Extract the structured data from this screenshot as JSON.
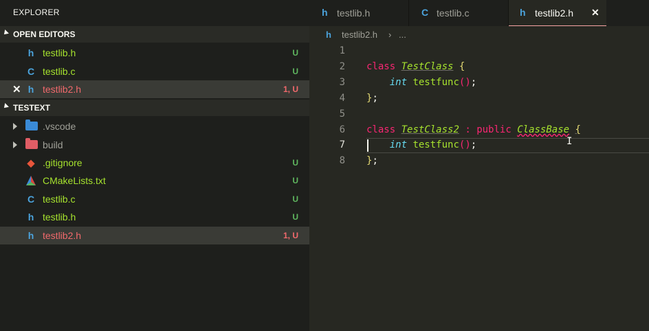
{
  "sidebar": {
    "title": "EXPLORER",
    "open_editors": {
      "label": "OPEN EDITORS",
      "items": [
        {
          "icon": "h",
          "name": "testlib.h",
          "badge": "U"
        },
        {
          "icon": "C",
          "name": "testlib.c",
          "badge": "U"
        },
        {
          "icon": "h",
          "name": "testlib2.h",
          "badge": "1, U",
          "close": "✕"
        }
      ]
    },
    "workspace": {
      "label": "TESTEXT",
      "items": [
        {
          "name": ".vscode"
        },
        {
          "name": "build"
        },
        {
          "name": ".gitignore",
          "badge": "U"
        },
        {
          "name": "CMakeLists.txt",
          "badge": "U"
        },
        {
          "icon": "C",
          "name": "testlib.c",
          "badge": "U"
        },
        {
          "icon": "h",
          "name": "testlib.h",
          "badge": "U"
        },
        {
          "icon": "h",
          "name": "testlib2.h",
          "badge": "1, U"
        }
      ]
    }
  },
  "tabs": [
    {
      "icon": "h",
      "label": "testlib.h"
    },
    {
      "icon": "C",
      "label": "testlib.c"
    },
    {
      "icon": "h",
      "label": "testlib2.h",
      "close": "✕"
    }
  ],
  "breadcrumb": {
    "icon": "h",
    "file": "testlib2.h",
    "sep": "›",
    "more": "..."
  },
  "editor": {
    "line_numbers": [
      "1",
      "2",
      "3",
      "4",
      "5",
      "6",
      "7",
      "8"
    ],
    "current_line": "7",
    "lines": {
      "l2": {
        "kw": "class",
        "name": "TestClass",
        "brace": "{"
      },
      "l3": {
        "type": "int",
        "fn": "testfunc",
        "paren": "()",
        "semi": ";"
      },
      "l4": {
        "brace": "}",
        "semi": ";"
      },
      "l6": {
        "kw": "class",
        "name": "TestClass2",
        "colon": ":",
        "access": "public",
        "base": "ClassBase",
        "brace": "{"
      },
      "l7": {
        "type": "int",
        "fn": "testfunc",
        "paren": "()",
        "semi": ";"
      },
      "l8": {
        "brace": "}",
        "semi": ";"
      }
    }
  },
  "colors": {
    "untracked_green": "#a6e22e",
    "error_red": "#f1696c",
    "keyword": "#f92672",
    "type": "#66d9ef",
    "bracket": "#e6db74"
  }
}
